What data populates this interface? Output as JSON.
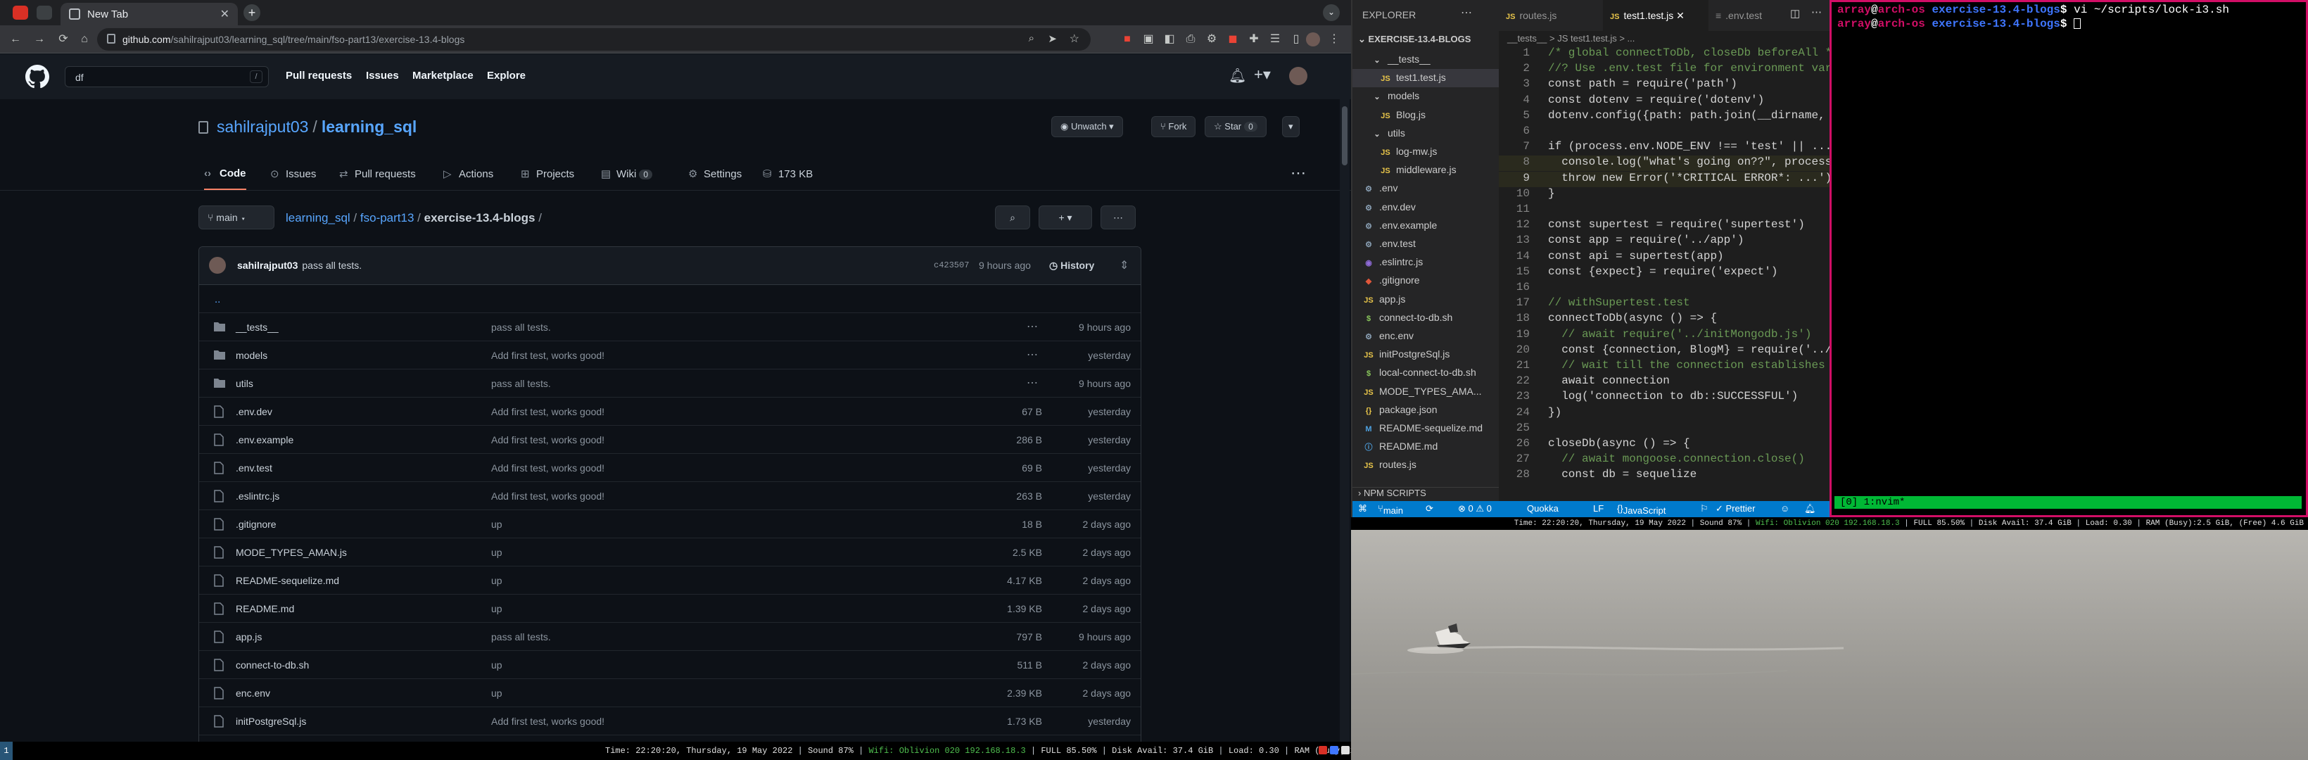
{
  "browser": {
    "tab_title": "New Tab",
    "url_host": "github.com",
    "url_path": "/sahilrajput03/learning_sql/tree/main/fso-part13/exercise-13.4-blogs"
  },
  "github": {
    "search_value": "df",
    "search_shortcut": "/",
    "nav": [
      "Pull requests",
      "Issues",
      "Marketplace",
      "Explore"
    ],
    "owner": "sahilrajput03",
    "repo": "learning_sql",
    "unwatch_label": "Unwatch",
    "fork_label": "Fork",
    "star_label": "Star",
    "star_count": "0",
    "tabs": [
      {
        "label": "Code"
      },
      {
        "label": "Issues"
      },
      {
        "label": "Pull requests"
      },
      {
        "label": "Actions"
      },
      {
        "label": "Projects"
      },
      {
        "label": "Wiki",
        "count": "0"
      },
      {
        "label": "Settings"
      },
      {
        "label": "173 KB"
      }
    ],
    "branch": "main",
    "breadcrumb": {
      "root": "learning_sql",
      "part": "fso-part13",
      "current": "exercise-13.4-blogs",
      "sep": "/"
    },
    "commit": {
      "author": "sahilrajput03",
      "message": "pass all tests.",
      "sha": "c423507",
      "time": "9 hours ago",
      "history": "History"
    },
    "updir": "..",
    "files": [
      {
        "name": "__tests__",
        "type": "dir",
        "message": "pass all tests.",
        "size": "",
        "age": "9 hours ago"
      },
      {
        "name": "models",
        "type": "dir",
        "message": "Add first test, works good!",
        "size": "",
        "age": "yesterday"
      },
      {
        "name": "utils",
        "type": "dir",
        "message": "pass all tests.",
        "size": "",
        "age": "9 hours ago"
      },
      {
        "name": ".env.dev",
        "type": "file",
        "message": "Add first test, works good!",
        "size": "67 B",
        "age": "yesterday"
      },
      {
        "name": ".env.example",
        "type": "file",
        "message": "Add first test, works good!",
        "size": "286 B",
        "age": "yesterday"
      },
      {
        "name": ".env.test",
        "type": "file",
        "message": "Add first test, works good!",
        "size": "69 B",
        "age": "yesterday"
      },
      {
        "name": ".eslintrc.js",
        "type": "file",
        "message": "Add first test, works good!",
        "size": "263 B",
        "age": "yesterday"
      },
      {
        "name": ".gitignore",
        "type": "file",
        "message": "up",
        "size": "18 B",
        "age": "2 days ago"
      },
      {
        "name": "MODE_TYPES_AMAN.js",
        "type": "file",
        "message": "up",
        "size": "2.5 KB",
        "age": "2 days ago"
      },
      {
        "name": "README-sequelize.md",
        "type": "file",
        "message": "up",
        "size": "4.17 KB",
        "age": "2 days ago"
      },
      {
        "name": "README.md",
        "type": "file",
        "message": "up",
        "size": "1.39 KB",
        "age": "2 days ago"
      },
      {
        "name": "app.js",
        "type": "file",
        "message": "pass all tests.",
        "size": "797 B",
        "age": "9 hours ago"
      },
      {
        "name": "connect-to-db.sh",
        "type": "file",
        "message": "up",
        "size": "511 B",
        "age": "2 days ago"
      },
      {
        "name": "enc.env",
        "type": "file",
        "message": "up",
        "size": "2.39 KB",
        "age": "2 days ago"
      },
      {
        "name": "initPostgreSql.js",
        "type": "file",
        "message": "Add first test, works good!",
        "size": "1.73 KB",
        "age": "yesterday"
      }
    ]
  },
  "vscode": {
    "explorer_title": "EXPLORER",
    "project": "EXERCISE-13.4-BLOGS",
    "tree": [
      {
        "label": "__tests__",
        "icon": "v"
      },
      {
        "label": "test1.test.js",
        "icon": "JS"
      },
      {
        "label": "models",
        "icon": "v"
      },
      {
        "label": "Blog.js",
        "icon": "JS"
      },
      {
        "label": "utils",
        "icon": "v"
      },
      {
        "label": "log-mw.js",
        "icon": "JS"
      },
      {
        "label": "middleware.js",
        "icon": "JS"
      },
      {
        "label": ".env",
        "icon": "⚙"
      },
      {
        "label": ".env.dev",
        "icon": "⚙"
      },
      {
        "label": ".env.example",
        "icon": "⚙"
      },
      {
        "label": ".env.test",
        "icon": "⚙"
      },
      {
        "label": ".eslintrc.js",
        "icon": "◉"
      },
      {
        "label": ".gitignore",
        "icon": "◆"
      },
      {
        "label": "app.js",
        "icon": "JS"
      },
      {
        "label": "connect-to-db.sh",
        "icon": "$"
      },
      {
        "label": "enc.env",
        "icon": "⚙"
      },
      {
        "label": "initPostgreSql.js",
        "icon": "JS"
      },
      {
        "label": "local-connect-to-db.sh",
        "icon": "$"
      },
      {
        "label": "MODE_TYPES_AMA...",
        "icon": "JS"
      },
      {
        "label": "package.json",
        "icon": "{}"
      },
      {
        "label": "README-sequelize.md",
        "icon": "M"
      },
      {
        "label": "README.md",
        "icon": "ⓘ"
      },
      {
        "label": "routes.js",
        "icon": "JS"
      }
    ],
    "npm_scripts": "NPM SCRIPTS",
    "tabs": [
      "routes.js",
      "test1.test.js",
      ".env.test"
    ],
    "breadcrumb": "__tests__ > JS test1.test.js > ...",
    "code": [
      {
        "n": "1",
        "t": "/* global connectToDb, closeDb beforeAll */",
        "c": "#6a9955"
      },
      {
        "n": "2",
        "t": "//? Use .env.test file for environment variables",
        "c": "#6a9955"
      },
      {
        "n": "3",
        "t": "const path = require('path')",
        "c": "#d4d4d4"
      },
      {
        "n": "4",
        "t": "const dotenv = require('dotenv')",
        "c": "#d4d4d4"
      },
      {
        "n": "5",
        "t": "dotenv.config({path: path.join(__dirname, '../.env.test')})",
        "c": "#d4d4d4"
      },
      {
        "n": "6",
        "t": "",
        "c": "#d4d4d4"
      },
      {
        "n": "7",
        "t": "if (process.env.NODE_ENV !== 'test' || ...) {",
        "c": "#d4d4d4"
      },
      {
        "n": "8",
        "t": "  console.log(\"what's going on??\", process.env)",
        "c": "#d4d4d4"
      },
      {
        "n": "9",
        "t": "  throw new Error('*CRITICAL ERROR*: ...')",
        "c": "#d4d4d4"
      },
      {
        "n": "10",
        "t": "}",
        "c": "#d4d4d4"
      },
      {
        "n": "11",
        "t": "",
        "c": "#d4d4d4"
      },
      {
        "n": "12",
        "t": "const supertest = require('supertest')",
        "c": "#d4d4d4"
      },
      {
        "n": "13",
        "t": "const app = require('../app')",
        "c": "#d4d4d4"
      },
      {
        "n": "14",
        "t": "const api = supertest(app)",
        "c": "#d4d4d4"
      },
      {
        "n": "15",
        "t": "const {expect} = require('expect')",
        "c": "#d4d4d4"
      },
      {
        "n": "16",
        "t": "",
        "c": "#d4d4d4"
      },
      {
        "n": "17",
        "t": "// withSupertest.test",
        "c": "#6a9955"
      },
      {
        "n": "18",
        "t": "connectToDb(async () => {",
        "c": "#d4d4d4"
      },
      {
        "n": "19",
        "t": "  // await require('../initMongodb.js')",
        "c": "#6a9955"
      },
      {
        "n": "20",
        "t": "  const {connection, BlogM} = require('../models')",
        "c": "#d4d4d4"
      },
      {
        "n": "21",
        "t": "  // wait till the connection establishes",
        "c": "#6a9955"
      },
      {
        "n": "22",
        "t": "  await connection",
        "c": "#d4d4d4"
      },
      {
        "n": "23",
        "t": "  log('connection to db::SUCCESSFUL')",
        "c": "#d4d4d4"
      },
      {
        "n": "24",
        "t": "})",
        "c": "#d4d4d4"
      },
      {
        "n": "25",
        "t": "",
        "c": "#d4d4d4"
      },
      {
        "n": "26",
        "t": "closeDb(async () => {",
        "c": "#d4d4d4"
      },
      {
        "n": "27",
        "t": "  // await mongoose.connection.close()",
        "c": "#6a9955"
      },
      {
        "n": "28",
        "t": "  const db = sequelize",
        "c": "#d4d4d4"
      }
    ],
    "status": {
      "branch": "main",
      "problems": "⊗ 0 ⚠ 0",
      "quokka": "Quokka",
      "eol": "LF",
      "lang": "JavaScript",
      "prettier": "✓ Prettier"
    }
  },
  "terminal": {
    "user": "array",
    "host": "arch-os",
    "cwd": "exercise-13.4-blogs",
    "cmd": " vi ~/scripts/lock-i3.sh",
    "prompt_char": "$",
    "tmux_status": "[0] 1:nvim*"
  },
  "statusbar": {
    "workspace": "1",
    "time": "Time: 22:20:20, Thursday, 19 May 2022",
    "sound": "Sound 87%",
    "wifi": "Wifi: Oblivion 020 192.168.18.3",
    "full": "FULL 85.50%",
    "disk": "Disk Avail: 37.4 GiB",
    "load": "Load: 0.30",
    "ram": "RAM (Busy):2.5 GiB, (Free) 4.6 GiB"
  },
  "colors": {
    "github_bg": "#0d1117",
    "github_link": "#58a6ff",
    "vscode_status": "#007acc",
    "terminal_border": "#d10e66",
    "tmux_bar": "#00b835"
  }
}
